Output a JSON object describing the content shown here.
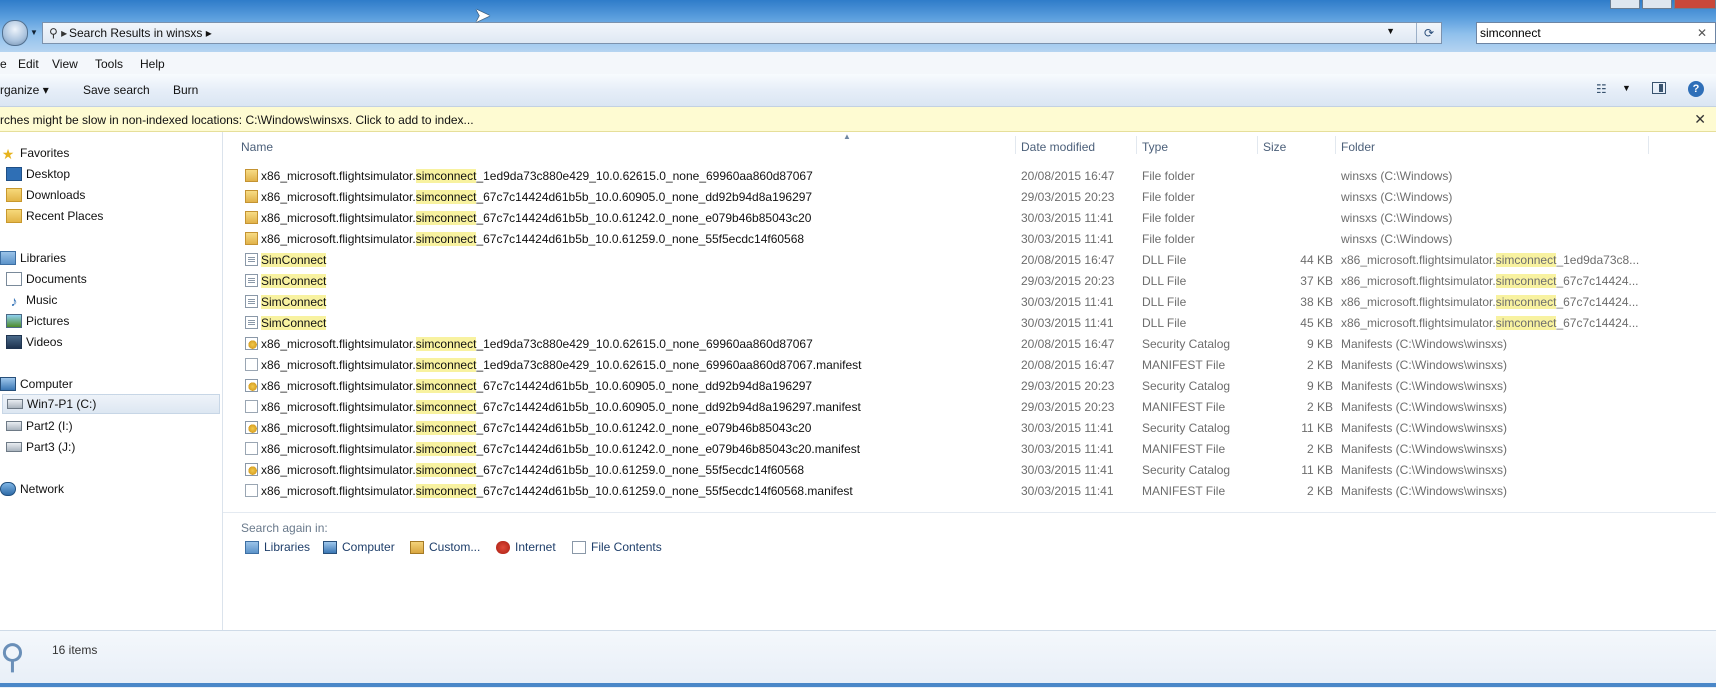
{
  "address": {
    "crumb": "Search Results in winsxs"
  },
  "search": {
    "value": "simconnect",
    "clear_glyph": "✕"
  },
  "menu": {
    "items": [
      "e",
      "Edit",
      "View",
      "Tools",
      "Help"
    ]
  },
  "toolbar": {
    "organize": "rganize ▾",
    "save_search": "Save search",
    "burn": "Burn",
    "help": "?"
  },
  "infobar": {
    "message": "rches might be slow in non-indexed locations: C:\\Windows\\winsxs. Click to add to index...",
    "close": "✕"
  },
  "nav": {
    "favorites": "Favorites",
    "desktop": "Desktop",
    "downloads": "Downloads",
    "recent": "Recent Places",
    "libraries": "Libraries",
    "documents": "Documents",
    "music": "Music",
    "pictures": "Pictures",
    "videos": "Videos",
    "computer": "Computer",
    "win7": "Win7-P1 (C:)",
    "part2": "Part2 (I:)",
    "part3": "Part3 (J:)",
    "network": "Network"
  },
  "columns": {
    "name": "Name",
    "date": "Date modified",
    "type": "Type",
    "size": "Size",
    "folder": "Folder"
  },
  "files": [
    {
      "icon": "folder",
      "pre": "x86_microsoft.flightsimulator.",
      "hl": "simconnect",
      "post": "_1ed9da73c880e429_10.0.62615.0_none_69960aa860d87067",
      "date": "20/08/2015 16:47",
      "type": "File folder",
      "size": "",
      "fpre": "winsxs (C:\\Windows)",
      "fhl": "",
      "fpost": ""
    },
    {
      "icon": "folder",
      "pre": "x86_microsoft.flightsimulator.",
      "hl": "simconnect",
      "post": "_67c7c14424d61b5b_10.0.60905.0_none_dd92b94d8a196297",
      "date": "29/03/2015 20:23",
      "type": "File folder",
      "size": "",
      "fpre": "winsxs (C:\\Windows)",
      "fhl": "",
      "fpost": ""
    },
    {
      "icon": "folder",
      "pre": "x86_microsoft.flightsimulator.",
      "hl": "simconnect",
      "post": "_67c7c14424d61b5b_10.0.61242.0_none_e079b46b85043c20",
      "date": "30/03/2015 11:41",
      "type": "File folder",
      "size": "",
      "fpre": "winsxs (C:\\Windows)",
      "fhl": "",
      "fpost": ""
    },
    {
      "icon": "folder",
      "pre": "x86_microsoft.flightsimulator.",
      "hl": "simconnect",
      "post": "_67c7c14424d61b5b_10.0.61259.0_none_55f5ecdc14f60568",
      "date": "30/03/2015 11:41",
      "type": "File folder",
      "size": "",
      "fpre": "winsxs (C:\\Windows)",
      "fhl": "",
      "fpost": ""
    },
    {
      "icon": "dll",
      "pre": "",
      "hl": "SimConnect",
      "post": "",
      "date": "20/08/2015 16:47",
      "type": "DLL File",
      "size": "44 KB",
      "fpre": "x86_microsoft.flightsimulator.",
      "fhl": "simconnect",
      "fpost": "_1ed9da73c8..."
    },
    {
      "icon": "dll",
      "pre": "",
      "hl": "SimConnect",
      "post": "",
      "date": "29/03/2015 20:23",
      "type": "DLL File",
      "size": "37 KB",
      "fpre": "x86_microsoft.flightsimulator.",
      "fhl": "simconnect",
      "fpost": "_67c7c14424..."
    },
    {
      "icon": "dll",
      "pre": "",
      "hl": "SimConnect",
      "post": "",
      "date": "30/03/2015 11:41",
      "type": "DLL File",
      "size": "38 KB",
      "fpre": "x86_microsoft.flightsimulator.",
      "fhl": "simconnect",
      "fpost": "_67c7c14424..."
    },
    {
      "icon": "dll",
      "pre": "",
      "hl": "SimConnect",
      "post": "",
      "date": "30/03/2015 11:41",
      "type": "DLL File",
      "size": "45 KB",
      "fpre": "x86_microsoft.flightsimulator.",
      "fhl": "simconnect",
      "fpost": "_67c7c14424..."
    },
    {
      "icon": "cat",
      "pre": "x86_microsoft.flightsimulator.",
      "hl": "simconnect",
      "post": "_1ed9da73c880e429_10.0.62615.0_none_69960aa860d87067",
      "date": "20/08/2015 16:47",
      "type": "Security Catalog",
      "size": "9 KB",
      "fpre": "Manifests (C:\\Windows\\winsxs)",
      "fhl": "",
      "fpost": ""
    },
    {
      "icon": "man",
      "pre": "x86_microsoft.flightsimulator.",
      "hl": "simconnect",
      "post": "_1ed9da73c880e429_10.0.62615.0_none_69960aa860d87067.manifest",
      "date": "20/08/2015 16:47",
      "type": "MANIFEST File",
      "size": "2 KB",
      "fpre": "Manifests (C:\\Windows\\winsxs)",
      "fhl": "",
      "fpost": ""
    },
    {
      "icon": "cat",
      "pre": "x86_microsoft.flightsimulator.",
      "hl": "simconnect",
      "post": "_67c7c14424d61b5b_10.0.60905.0_none_dd92b94d8a196297",
      "date": "29/03/2015 20:23",
      "type": "Security Catalog",
      "size": "9 KB",
      "fpre": "Manifests (C:\\Windows\\winsxs)",
      "fhl": "",
      "fpost": ""
    },
    {
      "icon": "man",
      "pre": "x86_microsoft.flightsimulator.",
      "hl": "simconnect",
      "post": "_67c7c14424d61b5b_10.0.60905.0_none_dd92b94d8a196297.manifest",
      "date": "29/03/2015 20:23",
      "type": "MANIFEST File",
      "size": "2 KB",
      "fpre": "Manifests (C:\\Windows\\winsxs)",
      "fhl": "",
      "fpost": ""
    },
    {
      "icon": "cat",
      "pre": "x86_microsoft.flightsimulator.",
      "hl": "simconnect",
      "post": "_67c7c14424d61b5b_10.0.61242.0_none_e079b46b85043c20",
      "date": "30/03/2015 11:41",
      "type": "Security Catalog",
      "size": "11 KB",
      "fpre": "Manifests (C:\\Windows\\winsxs)",
      "fhl": "",
      "fpost": ""
    },
    {
      "icon": "man",
      "pre": "x86_microsoft.flightsimulator.",
      "hl": "simconnect",
      "post": "_67c7c14424d61b5b_10.0.61242.0_none_e079b46b85043c20.manifest",
      "date": "30/03/2015 11:41",
      "type": "MANIFEST File",
      "size": "2 KB",
      "fpre": "Manifests (C:\\Windows\\winsxs)",
      "fhl": "",
      "fpost": ""
    },
    {
      "icon": "cat",
      "pre": "x86_microsoft.flightsimulator.",
      "hl": "simconnect",
      "post": "_67c7c14424d61b5b_10.0.61259.0_none_55f5ecdc14f60568",
      "date": "30/03/2015 11:41",
      "type": "Security Catalog",
      "size": "11 KB",
      "fpre": "Manifests (C:\\Windows\\winsxs)",
      "fhl": "",
      "fpost": ""
    },
    {
      "icon": "man",
      "pre": "x86_microsoft.flightsimulator.",
      "hl": "simconnect",
      "post": "_67c7c14424d61b5b_10.0.61259.0_none_55f5ecdc14f60568.manifest",
      "date": "30/03/2015 11:41",
      "type": "MANIFEST File",
      "size": "2 KB",
      "fpre": "Manifests (C:\\Windows\\winsxs)",
      "fhl": "",
      "fpost": ""
    }
  ],
  "search_again": {
    "title": "Search again in:",
    "libraries": "Libraries",
    "computer": "Computer",
    "custom": "Custom...",
    "internet": "Internet",
    "file_contents": "File Contents"
  },
  "status": {
    "count": "16 items"
  }
}
